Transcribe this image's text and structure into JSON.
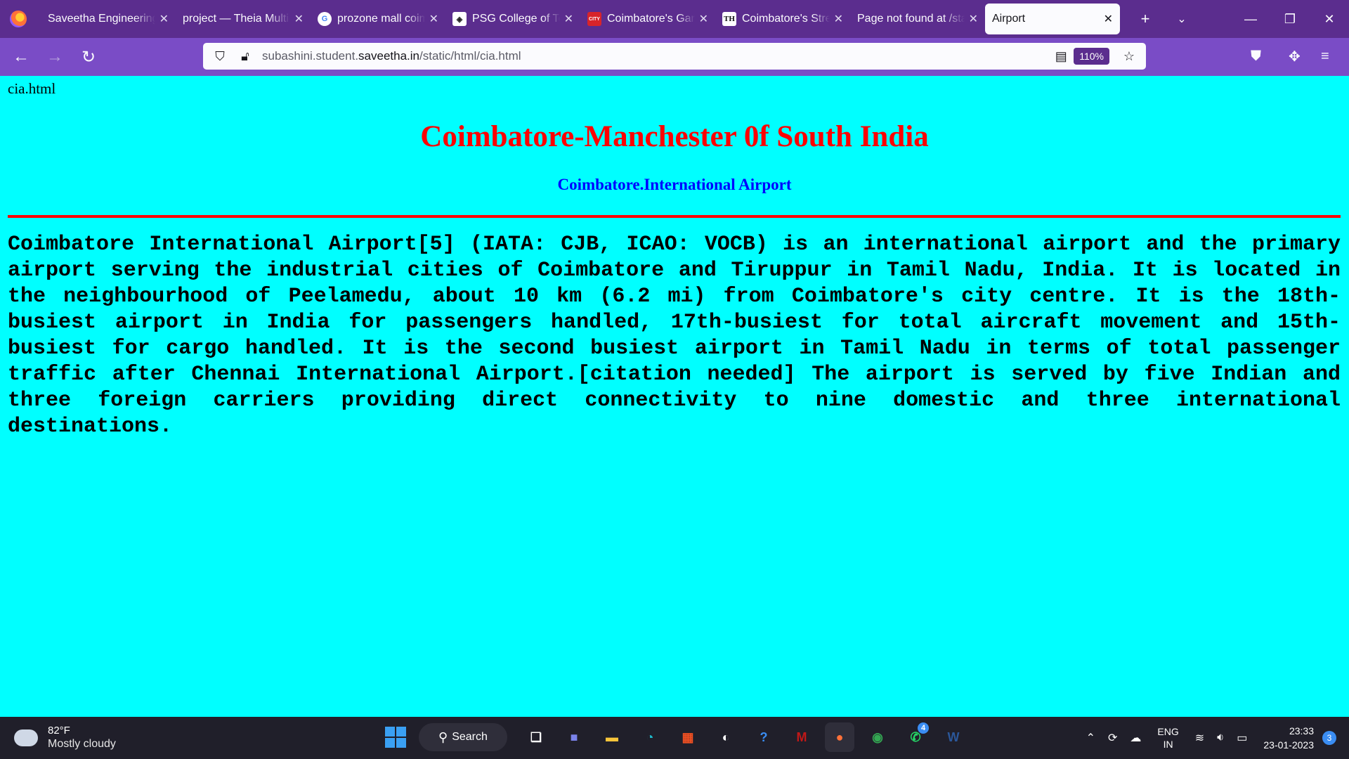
{
  "tabs": [
    {
      "title": "Saveetha Engineering",
      "favicon": "",
      "favicon_color": ""
    },
    {
      "title": "project — Theia Multi-",
      "favicon": "",
      "favicon_color": ""
    },
    {
      "title": "prozone mall coimbatore",
      "favicon": "G",
      "favicon_color": "#ffffff"
    },
    {
      "title": "PSG College of Technology",
      "favicon": "",
      "favicon_color": "#ffffff"
    },
    {
      "title": "Coimbatore's Gangs",
      "favicon": "CITY",
      "favicon_color": "#d8242a"
    },
    {
      "title": "Coimbatore's Street",
      "favicon": "TH",
      "favicon_color": "#ffffff"
    },
    {
      "title": "Page not found at /static",
      "favicon": "",
      "favicon_color": ""
    },
    {
      "title": "Airport",
      "favicon": "",
      "favicon_color": "",
      "active": true
    }
  ],
  "address": {
    "prefix": "subashini.student.",
    "domain": "saveetha.in",
    "path": "/static/html/cia.html",
    "zoom": "110%"
  },
  "page": {
    "label": "cia.html",
    "heading": "Coimbatore-Manchester 0f South India",
    "subheading": "Coimbatore.International Airport",
    "paragraph": "Coimbatore International Airport[5] (IATA: CJB, ICAO: VOCB) is an international airport and the primary airport serving the industrial cities of Coimbatore and Tiruppur in Tamil Nadu, India. It is located in the neighbourhood of Peelamedu, about 10 km (6.2 mi) from Coimbatore's city centre. It is the 18th-busiest airport in India for passengers handled, 17th-busiest for total aircraft movement and 15th-busiest for cargo handled. It is the second busiest airport in Tamil Nadu in terms of total passenger traffic after Chennai International Airport.[citation needed] The airport is served by five Indian and three foreign carriers providing direct connectivity to nine domestic and three international destinations."
  },
  "taskbar": {
    "weather_temp": "82°F",
    "weather_desc": "Mostly cloudy",
    "search_label": "Search",
    "whatsapp_badge": "4",
    "lang_top": "ENG",
    "lang_bottom": "IN",
    "time": "23:33",
    "date": "23-01-2023",
    "notifications": "3"
  },
  "colors": {
    "page_bg": "#00ffff",
    "heading": "#ff0000",
    "subheading": "#0000ff",
    "browser_chrome": "#5b2d8e"
  }
}
